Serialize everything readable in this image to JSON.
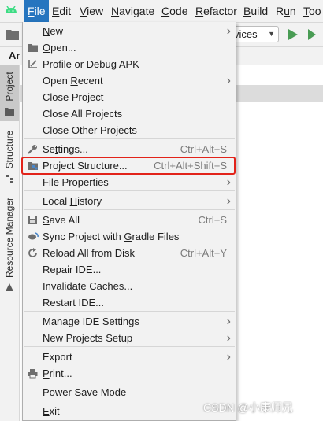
{
  "menubar": {
    "items": [
      {
        "label": "File",
        "mnemonic": "F",
        "rest": "ile",
        "active": true
      },
      {
        "label": "Edit",
        "mnemonic": "E",
        "rest": "dit"
      },
      {
        "label": "View",
        "mnemonic": "V",
        "rest": "iew"
      },
      {
        "label": "Navigate",
        "mnemonic": "N",
        "rest": "avigate"
      },
      {
        "label": "Code",
        "mnemonic": "C",
        "rest": "ode"
      },
      {
        "label": "Refactor",
        "mnemonic": "R",
        "rest": "efactor"
      },
      {
        "label": "Build",
        "mnemonic": "B",
        "rest": "uild"
      },
      {
        "label": "Run",
        "mnemonic": "u",
        "pre": "R",
        "rest": "n"
      },
      {
        "label": "Too",
        "mnemonic": "T",
        "rest": "oo"
      }
    ]
  },
  "toolbar": {
    "config_text": "vices"
  },
  "tab_label": "Ar",
  "side_tabs": {
    "project": "Project",
    "structure": "Structure",
    "resource_manager": "Resource Manager"
  },
  "file_menu": {
    "items": [
      {
        "id": "new",
        "pre": "",
        "mn": "N",
        "post": "ew",
        "submenu": true
      },
      {
        "id": "open",
        "pre": "",
        "mn": "O",
        "post": "pen...",
        "icon": "folder-icon"
      },
      {
        "id": "profile",
        "pre": "Profile or Debug APK",
        "mn": "",
        "post": "",
        "icon": "profile-apk-icon"
      },
      {
        "id": "open-recent",
        "pre": "Open ",
        "mn": "R",
        "post": "ecent",
        "submenu": true
      },
      {
        "id": "close-project",
        "pre": "Close Project",
        "mn": "",
        "post": ""
      },
      {
        "id": "close-all",
        "pre": "Close All Projects",
        "mn": "",
        "post": ""
      },
      {
        "id": "close-other",
        "pre": "Close Other Projects",
        "mn": "",
        "post": ""
      },
      {
        "id": "settings",
        "pre": "Se",
        "mn": "t",
        "post": "tings...",
        "shortcut": "Ctrl+Alt+S",
        "icon": "wrench-icon"
      },
      {
        "id": "project-structure",
        "pre": "Project Structure...",
        "mn": "",
        "post": "",
        "shortcut": "Ctrl+Alt+Shift+S",
        "icon": "project-structure-icon"
      },
      {
        "id": "file-properties",
        "pre": "File Properties",
        "mn": "",
        "post": "",
        "submenu": true
      },
      {
        "id": "local-history",
        "pre": "Local ",
        "mn": "H",
        "post": "istory",
        "submenu": true
      },
      {
        "id": "save-all",
        "pre": "",
        "mn": "S",
        "post": "ave All",
        "shortcut": "Ctrl+S",
        "icon": "save-icon"
      },
      {
        "id": "sync-gradle",
        "pre": "Sync Project with ",
        "mn": "G",
        "post": "radle Files",
        "icon": "gradle-sync-icon"
      },
      {
        "id": "reload",
        "pre": "Reload All from Disk",
        "mn": "",
        "post": "",
        "shortcut": "Ctrl+Alt+Y",
        "icon": "reload-icon"
      },
      {
        "id": "repair",
        "pre": "Repair IDE...",
        "mn": "",
        "post": ""
      },
      {
        "id": "invalidate",
        "pre": "Invalidate Caches...",
        "mn": "",
        "post": ""
      },
      {
        "id": "restart",
        "pre": "Restart IDE...",
        "mn": "",
        "post": ""
      },
      {
        "id": "manage-settings",
        "pre": "Manage IDE Settings",
        "mn": "",
        "post": "",
        "submenu": true
      },
      {
        "id": "new-projects-setup",
        "pre": "New Projects Setup",
        "mn": "",
        "post": "",
        "submenu": true
      },
      {
        "id": "export",
        "pre": "Export",
        "mn": "",
        "post": "",
        "submenu": true
      },
      {
        "id": "print",
        "pre": "",
        "mn": "P",
        "post": "rint...",
        "icon": "print-icon"
      },
      {
        "id": "power-save",
        "pre": "Power Save Mode",
        "mn": "",
        "post": ""
      },
      {
        "id": "exit",
        "pre": "",
        "mn": "E",
        "post": "xit"
      }
    ]
  },
  "watermark": "CSDN @小康师兄",
  "colors": {
    "menu_active": "#2675bf",
    "highlight_box": "#e2231a",
    "android_green": "#3ddc84",
    "run_green": "#499c54"
  }
}
